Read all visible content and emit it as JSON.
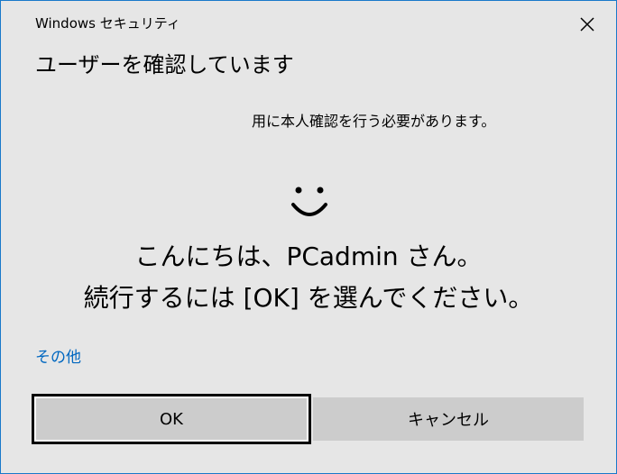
{
  "window": {
    "title": "Windows セキュリティ"
  },
  "dialog": {
    "heading": "ユーザーを確認しています",
    "message": "用に本人確認を行う必要があります。",
    "greeting": "こんにちは、PCadmin さん。",
    "instruction": "続行するには [OK] を選んでください。",
    "more_link": "その他",
    "face_icon": "smile-icon"
  },
  "buttons": {
    "ok_label": "OK",
    "cancel_label": "キャンセル"
  },
  "colors": {
    "border": "#1979ca",
    "background": "#e6e6e6",
    "link": "#0067c0",
    "button": "#cccccc"
  }
}
